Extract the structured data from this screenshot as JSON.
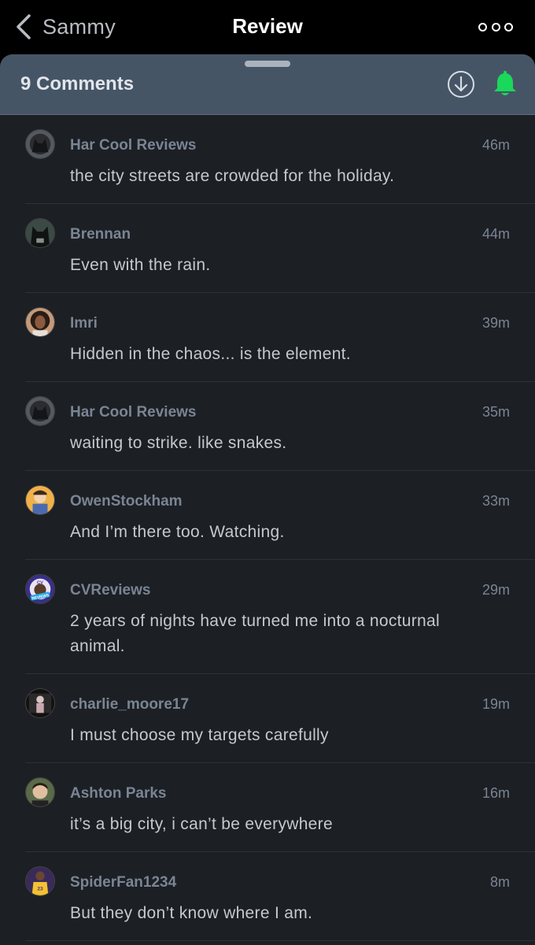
{
  "nav": {
    "back_label": "Sammy",
    "title": "Review"
  },
  "sheet": {
    "comment_count": "9 Comments"
  },
  "comments": [
    {
      "user": "Har Cool Reviews",
      "time": "46m",
      "text": "the city streets are crowded for the holiday.",
      "avatar": "batman-dark-avatar"
    },
    {
      "user": "Brennan",
      "time": "44m",
      "text": "Even with the rain.",
      "avatar": "batman-cowl-avatar"
    },
    {
      "user": "Imri",
      "time": "39m",
      "text": "Hidden in the chaos... is the element.",
      "avatar": "portrait-avatar"
    },
    {
      "user": "Har Cool Reviews",
      "time": "35m",
      "text": "waiting to strike. like snakes.",
      "avatar": "batman-dark-avatar"
    },
    {
      "user": "OwenStockham",
      "time": "33m",
      "text": "And I’m there too. Watching.",
      "avatar": "cartoon-avatar"
    },
    {
      "user": "CVReviews",
      "time": "29m",
      "text": "2 years of nights have turned me into a nocturnal animal.",
      "avatar": "cv-reviews-logo",
      "logo_text": "CV REVIEWS"
    },
    {
      "user": "charlie_moore17",
      "time": "19m",
      "text": "I must choose my targets carefully",
      "avatar": "figure-avatar"
    },
    {
      "user": "Ashton Parks",
      "time": "16m",
      "text": "it’s a big city, i can’t be everywhere",
      "avatar": "selfie-avatar"
    },
    {
      "user": "SpiderFan1234",
      "time": "8m",
      "text": "But they don’t know where I am.",
      "avatar": "jersey-avatar"
    }
  ],
  "icons": {
    "back": "chevron-left-icon",
    "more": "more-dots-icon",
    "download": "download-circle-icon",
    "notifications": "bell-icon"
  },
  "colors": {
    "bell_accent": "#19d85a",
    "header_bg": "#465566",
    "sheet_bg": "#1c1f24"
  }
}
